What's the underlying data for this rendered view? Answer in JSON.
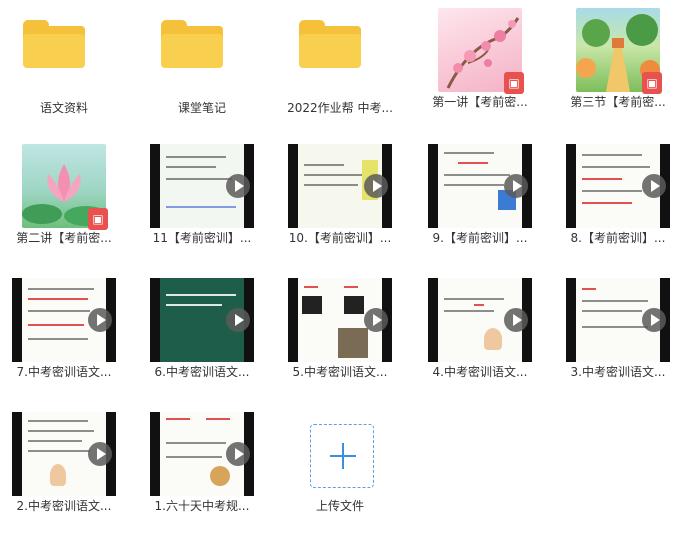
{
  "items": [
    {
      "type": "folder",
      "label": "语文资料"
    },
    {
      "type": "folder",
      "label": "课堂笔记"
    },
    {
      "type": "folder",
      "label": "2022作业帮 中考..."
    },
    {
      "type": "pdf",
      "label": "第一讲【考前密..."
    },
    {
      "type": "pdf",
      "label": "第三节【考前密..."
    },
    {
      "type": "pdf",
      "label": "第二讲【考前密..."
    },
    {
      "type": "video",
      "label": "11【考前密训】..."
    },
    {
      "type": "video",
      "label": "10.【考前密训】..."
    },
    {
      "type": "video",
      "label": "9.【考前密训】..."
    },
    {
      "type": "video",
      "label": "8.【考前密训】..."
    },
    {
      "type": "video",
      "label": "7.中考密训语文..."
    },
    {
      "type": "video",
      "label": "6.中考密训语文..."
    },
    {
      "type": "video",
      "label": "5.中考密训语文..."
    },
    {
      "type": "video",
      "label": "4.中考密训语文..."
    },
    {
      "type": "video",
      "label": "3.中考密训语文..."
    },
    {
      "type": "video",
      "label": "2.中考密训语文..."
    },
    {
      "type": "video",
      "label": "1.六十天中考规..."
    }
  ],
  "upload": {
    "label": "上传文件"
  },
  "icons": {
    "folder": "folder-icon",
    "pdf": "pdf-icon",
    "play": "play-icon",
    "plus": "plus-icon"
  },
  "colors": {
    "folder": "#f9cf4f",
    "pdf_badge": "#e8514d",
    "upload_accent": "#3a8fe0"
  }
}
